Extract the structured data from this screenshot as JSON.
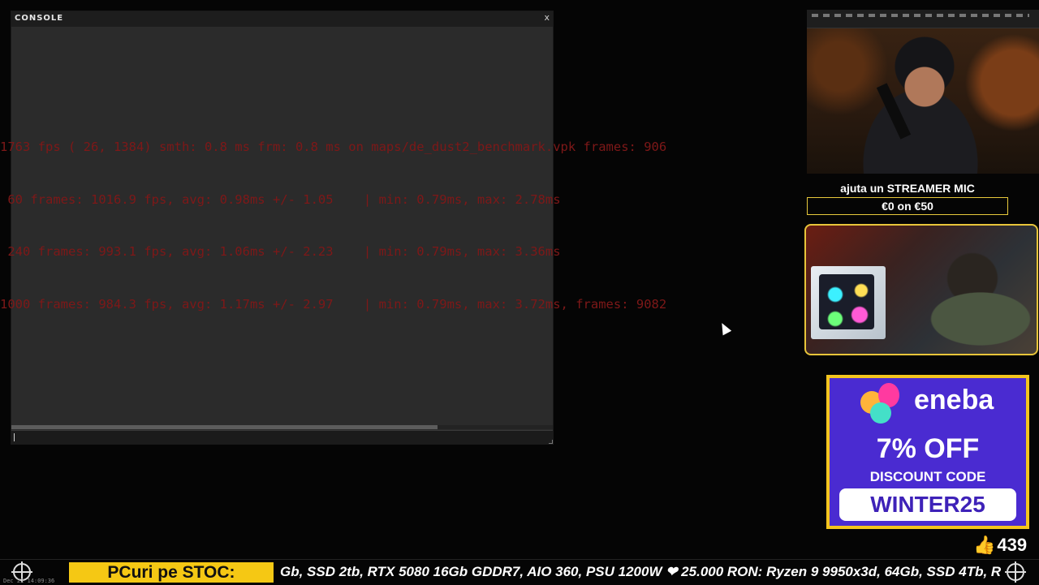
{
  "console": {
    "title": "CONSOLE",
    "close_label": "x",
    "input_value": ""
  },
  "benchmark": {
    "lines": [
      "1763 fps ( 26, 1384) smth: 0.8 ms frm: 0.8 ms on maps/de_dust2_benchmark.vpk frames: 906",
      " 60 frames: 1016.9 fps, avg: 0.98ms +/- 1.05    | min: 0.79ms, max: 2.78ms",
      " 240 frames: 993.1 fps, avg: 1.06ms +/- 2.23    | min: 0.79ms, max: 3.36ms",
      "1000 frames: 984.3 fps, avg: 1.17ms +/- 2.97    | min: 0.79ms, max: 3.72ms, frames: 9082"
    ]
  },
  "donation": {
    "title": "ajuta un STREAMER MIC",
    "goal": "€0 on €50"
  },
  "ad": {
    "brand": "eneba",
    "offer": "7% OFF",
    "subtitle": "DISCOUNT CODE",
    "code": "WINTER25",
    "colors": {
      "background": "#4a2bd1",
      "border": "#f4c51e"
    }
  },
  "likes": {
    "count": "439",
    "icon": "thumbs-up-icon"
  },
  "ticker": {
    "label": "PCuri pe STOC:",
    "text": "Gb, SSD 2tb, RTX 5080 16Gb GDDR7, AIO 360, PSU 1200W ❤ 25.000 RON: Ryzen 9 9950x3d, 64Gb, SSD 4Tb, R",
    "timestamp": "Dec 22 14:09:36"
  }
}
